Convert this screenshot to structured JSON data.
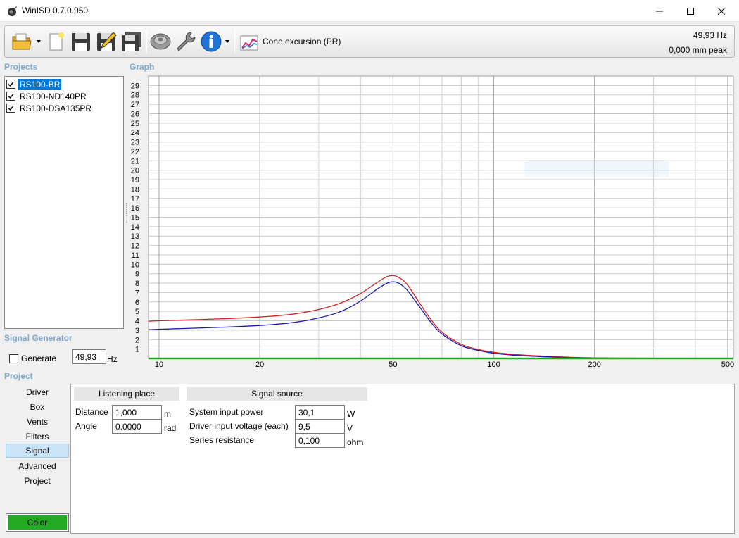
{
  "window": {
    "title": "WinISD 0.7.0.950"
  },
  "toolbar": {
    "icons": [
      "folder-open-icon",
      "new-file-icon",
      "save-icon",
      "save-as-icon",
      "save-all-icon",
      "driver-icon",
      "tools-icon",
      "info-icon",
      "chart-icon"
    ],
    "graph_selector": "Cone excursion (PR)",
    "frequency_readout": "49,93 Hz",
    "value_readout": "0,000 mm peak"
  },
  "projects": {
    "title": "Projects",
    "items": [
      {
        "label": "RS100-BR",
        "checked": true,
        "selected": true
      },
      {
        "label": "RS100-ND140PR",
        "checked": true,
        "selected": false
      },
      {
        "label": "RS100-DSA135PR",
        "checked": true,
        "selected": false
      }
    ]
  },
  "graph": {
    "title": "Graph"
  },
  "signal_generator": {
    "title": "Signal Generator",
    "generate_label": "Generate",
    "generate_checked": false,
    "frequency": "49,93",
    "unit": "Hz"
  },
  "project": {
    "title": "Project",
    "tabs": [
      "Driver",
      "Box",
      "Vents",
      "Filters",
      "Signal",
      "Advanced",
      "Project"
    ],
    "active_tab": "Signal",
    "color_label": "Color",
    "color_value": "#22aa22"
  },
  "signal": {
    "listening_place": {
      "title": "Listening place",
      "distance_label": "Distance",
      "distance_value": "1,000",
      "distance_unit": "m",
      "angle_label": "Angle",
      "angle_value": "0,0000",
      "angle_unit": "rad"
    },
    "signal_source": {
      "title": "Signal source",
      "power_label": "System input power",
      "power_value": "30,1",
      "power_unit": "W",
      "voltage_label": "Driver input voltage (each)",
      "voltage_value": "9,5",
      "voltage_unit": "V",
      "resistance_label": "Series resistance",
      "resistance_value": "0,100",
      "resistance_unit": "ohm"
    }
  },
  "chart_data": {
    "type": "line",
    "title": "",
    "xlabel": "",
    "ylabel": "",
    "x_scale": "log",
    "xlim": [
      9.3,
      520
    ],
    "ylim": [
      0,
      30
    ],
    "x_ticks": [
      10,
      20,
      50,
      100,
      200,
      500
    ],
    "y_ticks": [
      1,
      2,
      3,
      4,
      5,
      6,
      7,
      8,
      9,
      10,
      11,
      12,
      13,
      14,
      15,
      16,
      17,
      18,
      19,
      20,
      21,
      22,
      23,
      24,
      25,
      26,
      27,
      28,
      29
    ],
    "grid": true,
    "legend": "none",
    "series": [
      {
        "color": "#cc2222",
        "x": [
          9.3,
          10,
          15,
          20,
          25,
          30,
          35,
          40,
          45,
          48,
          50,
          52,
          55,
          60,
          65,
          70,
          80,
          90,
          100,
          120,
          150,
          170,
          200,
          300,
          520
        ],
        "y": [
          3.95,
          4.0,
          4.2,
          4.4,
          4.7,
          5.2,
          5.9,
          6.9,
          8.1,
          8.7,
          8.8,
          8.6,
          7.9,
          5.9,
          4.1,
          2.8,
          1.5,
          0.95,
          0.65,
          0.38,
          0.2,
          0.12,
          0.07,
          0.02,
          0.0
        ]
      },
      {
        "color": "#1a1aaa",
        "x": [
          9.3,
          10,
          15,
          20,
          25,
          30,
          35,
          40,
          45,
          48,
          50,
          52,
          55,
          60,
          65,
          70,
          80,
          90,
          100,
          120,
          150,
          170,
          200,
          300,
          520
        ],
        "y": [
          3.05,
          3.1,
          3.3,
          3.5,
          3.8,
          4.3,
          5.0,
          6.1,
          7.4,
          8.0,
          8.15,
          8.0,
          7.3,
          5.5,
          3.8,
          2.6,
          1.35,
          0.85,
          0.55,
          0.3,
          0.15,
          0.08,
          0.04,
          0.01,
          0.0
        ]
      },
      {
        "color": "#22aa22",
        "x": [
          9.3,
          520
        ],
        "y": [
          0.0,
          0.0
        ]
      }
    ]
  }
}
